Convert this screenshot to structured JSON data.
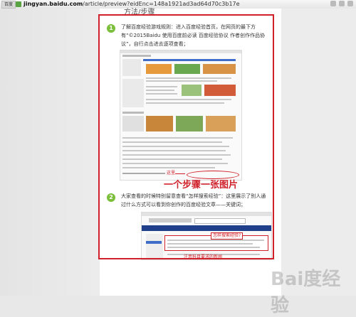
{
  "browser": {
    "favicon_label": "百度",
    "url_domain": "jingyan.baidu.com",
    "url_path": "/article/preview?eidEnc=148a1921ad3ad64d70c3b17e"
  },
  "article": {
    "section_heading": "方法/步骤",
    "steps": [
      {
        "number": "1",
        "text": "了解百度经验游戏规则：进入百度经验首页，在网页的最下方有“©2015Baidu 使用百度前必读 百度经验协议 作者创作作品协议”，自行点击进去逐项查看；"
      },
      {
        "number": "2",
        "text": "大家查看的时候特别留意查看“怎样搜索经验”：这里展示了别人通过什么方式可以看到你创作的百度经验文章——关键词；"
      }
    ]
  },
  "annotations": {
    "here_label": "这里",
    "one_step_one_image": "一个步骤一张图片",
    "keyword_note": "怎样搜索经验?",
    "bottom_note": "注意科目要求的新闻"
  },
  "watermark": "Bai度经验"
}
